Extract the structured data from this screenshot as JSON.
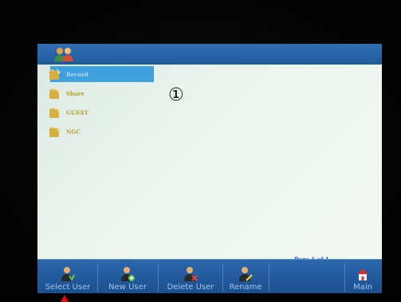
{
  "app": {
    "icon": "users-icon"
  },
  "user_list": {
    "items": [
      {
        "label": "Record",
        "icon": "folder-icon",
        "selected": true
      },
      {
        "label": "Share",
        "icon": "folder-icon",
        "selected": false
      },
      {
        "label": "GUEST",
        "icon": "folder-icon",
        "selected": false
      },
      {
        "label": "NGC",
        "icon": "folder-icon",
        "selected": false
      }
    ]
  },
  "annotation": {
    "marker": "①"
  },
  "pagination": {
    "label": "Page 1 of 1"
  },
  "toolbar": {
    "select_user": "Select User",
    "new_user": "New User",
    "delete_user": "Delete User",
    "rename": "Rename",
    "main": "Main"
  },
  "colors": {
    "topbar": "#2f6fb5",
    "selection": "#3fa0e0",
    "toolbar": "#2b67ad",
    "pointer": "#e01010"
  }
}
